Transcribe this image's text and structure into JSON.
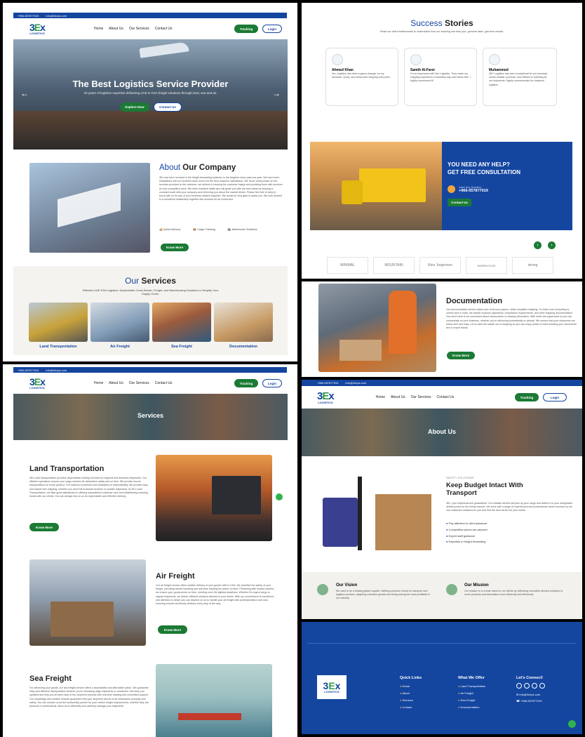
{
  "topbar": {
    "phone": "+966-557877019",
    "email": "info@3exps.com"
  },
  "brand": {
    "name": "3Ex",
    "word": "LOGISTICS",
    "tagline": "3Ex Logistics"
  },
  "nav": {
    "items": [
      "Home",
      "About Us",
      "Our Services",
      "Contact Us"
    ],
    "tracking": "Tracking",
    "login": "Login"
  },
  "hero": {
    "title": "The Best Logistics Service Provider",
    "subtitle": "20 years of logistics expertise delivering UAE to KSA freight solutions through land, sea and air.",
    "explore": "Explore Now",
    "contact": "Contact Us"
  },
  "about": {
    "heading_a": "About",
    "heading_b": "Our Company",
    "body": "3Ex has been involved in the freight forwarding business in the kingdom since past one year. We have been established with an excellent track record for the best customer satisfaction. We never compromise on the services provided to the customer, we believe in keeping the customer happy and providing them with services at very competitive price. We have excellent staffs who will guide you with the best ideas by keeping in constant touch with your company and informing you about the market trends. Please feel free to keep in touch with us for any of your business related enquiries. We would be very glad to assist you. We look forward to a wonderful relationship together and success for all concerned.",
    "features": [
      "Quick Delivery",
      "Cargo Tracking",
      "Warehouse Solutions"
    ],
    "button": "Know More"
  },
  "services": {
    "heading_a": "Our",
    "heading_b": "Services",
    "subtitle": "Effective UAE-KSA Logistics: Dependable Cross-Border, Freight, and Warehousing Solutions to Simplify Your Supply Chain.",
    "items": [
      "Land Transportation",
      "Air Freight",
      "Sea Freight",
      "Documentation"
    ]
  },
  "stories": {
    "heading_a": "Success",
    "heading_b": "Stories",
    "subtitle": "Read our client testimonials to understand how our tracking can help you, genuine tales, genuine results.",
    "items": [
      {
        "name": "Ahmed Khan",
        "text": "3ex Logistics has been a game-changer for my business. Quick, and stress-free shipping every time."
      },
      {
        "name": "Samih Al-Farsi",
        "text": "I'm so impressed with 3ex Logistics. They made my shipping experience a seamless day and stress-free. I highly recommend it!"
      },
      {
        "name": "Muhammed",
        "text": "3EX Logistics has been exceptional for our business needs reliable, punctual, and efficient in handling all our shipments. Highly recommended for business logistics."
      }
    ]
  },
  "help": {
    "title_1": "YOU NEED ANY HELP?",
    "title_2": "GET FREE CONSULTATION",
    "label": "Have Any Question",
    "phone": "+966-557877019",
    "button": "Contact Us"
  },
  "partners": [
    "MINIMAL",
    "MOUNTAIN",
    "Nino Jorgensen",
    "WAREHOUSE",
    "strong"
  ],
  "documentation": {
    "title": "Documentation",
    "body": "Our documentation service takes care of all your papers, which simplifies shipping. To make sure everything is correct and in order, we handle customs paperwork, compliance requirements, and other shipping documentation. You won't have to be concerned about inaccuracies or missing information. With entire the paperwork so you can concentrate on your business, whether you're delivering domestically or abroad. We ensure that your shipments are stress-free and easy. Let us take the hassle out of shipping so you can enjoy peace of mind knowing your documents are in expert hands.",
    "button": "Know More"
  },
  "services_page": {
    "banner": "Services",
    "land": {
      "title": "Land Transportation",
      "body": "3Ex Land transportation provides dependable trucking services for regional and domestic shipments. Our efficient operations ensure your cargo reaches its destination safely and on time. We provide secure transportation for every product. Our network of partners and dedication to dependability. We provide easy and hassle-free shipping, whether you need full truckload services or smaller shipments. At 3Ex Land Transportation, we take great satisfaction in offering unparalleled customer care and establishing enduring bonds with our clients. You can always rely on us for dependable and effective delivery.",
      "button": "Know More"
    },
    "air": {
      "title": "Air Freight",
      "body": "Our air freight service offers reliable delivery of your goods UAE to KSA. We prioritize the safety of your freight, providing careful handling and real-time tracking for peace of mind. Partnering with trusted carriers, we ensure your goods arrive on time, meeting even the tightest deadlines. Whether it's urgent cargo or regular shipments, we deliver efficient solutions tailored to your needs. With our commitment to excellence and attention to detail, you can depend on us to handle your air freight with professionalism and care, ensuring smooth and timely delivery every step of the way.",
      "button": "Know More"
    },
    "sea": {
      "title": "Sea Freight",
      "body": "For delivering your goods, our sea freight service offers a dependable and affordable option. We guarantee easy and effective transportation whether you're relocating large shipments or containers. We keep you updated and help you at every step of the shipment process with real-time tracking and committed support. Our knowledge and reliable network guarantee that your shipment arrives at its destination promptly and safely. You can choose us as the trustworthy partner for your marine freight requirements, whether they are personal or professional. Allow us to efficiently and carefully manage your shipments."
    }
  },
  "about_page": {
    "banner": "About Us",
    "eyebrow": "SAFETY SOLUTIONS",
    "title_1": "Keep Budget Intact With",
    "title_2": "Transport",
    "body": "3Ex, your shipments are guaranteed. Our reliable carriers will pick up your cargo and deliver it to your designated delivery point on the timely manner. We work with a range of experienced and professional carrier services so we can customize solutions for you and find the best carrier for your needs.",
    "bullets": [
      "Pay attention to client pleasure",
      "Competitive prices are assured",
      "Expert staff guidance",
      "Expertise in freight forwarding"
    ],
    "vision": {
      "title": "Our Vision",
      "text": "We want to be a leading global supplier, fulfilling customer needs for transport and logistics services, targeting extensive growth and being among the most profitable in our industry."
    },
    "mission": {
      "title": "Our Mission",
      "text": "Our mission is to create value for our clients by delivering innovative tailored solutions to move products and information more efficiently and effectively."
    }
  },
  "footer": {
    "quick_title": "Quick Links",
    "quick": [
      "Home",
      "About",
      "Services",
      "Contact"
    ],
    "offer_title": "What We Offer",
    "offer": [
      "Land Transportation",
      "Air Freight",
      "Sea Freight",
      "Documentation"
    ],
    "connect_title": "Let's Connect!",
    "email": "info@3exps.com",
    "phone": "+966-557877019"
  },
  "colors": {
    "brand_blue": "#1446a0",
    "brand_green": "#1b7a34"
  }
}
